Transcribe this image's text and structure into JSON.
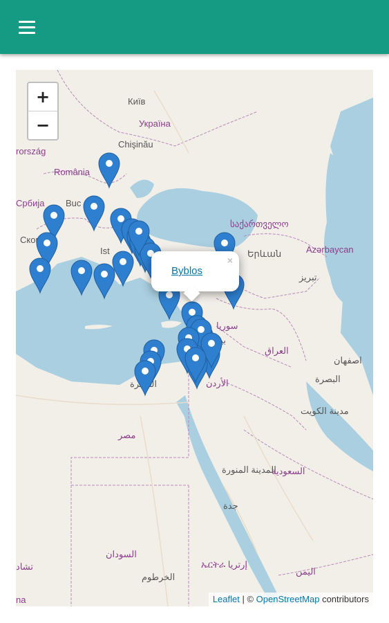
{
  "appbar": {
    "menu_icon": "hamburger-menu-icon",
    "color": "#159b84"
  },
  "map": {
    "zoom_in": "+",
    "zoom_out": "−",
    "popup": {
      "title": "Byblos",
      "close": "×"
    },
    "attribution": {
      "leaflet": "Leaflet",
      "sep": " | © ",
      "osm": "OpenStreetMap",
      "tail": " contributors"
    },
    "marker_color": "#2e7fcf",
    "labels": [
      {
        "text": "Київ",
        "color": "#555"
      },
      {
        "text": "Україна",
        "color": "#8a3d8a"
      },
      {
        "text": "Chişinău",
        "color": "#555"
      },
      {
        "text": "România",
        "color": "#8a3d8a"
      },
      {
        "text": "Buc",
        "color": "#555"
      },
      {
        "text": "Ist",
        "color": "#555"
      },
      {
        "text": "Скоп",
        "color": "#555"
      },
      {
        "text": "Србија",
        "color": "#8a3d8a"
      },
      {
        "text": "rország",
        "color": "#8a3d8a"
      },
      {
        "text": "საქართველო",
        "color": "#8a3d8a"
      },
      {
        "text": "Երևան",
        "color": "#555"
      },
      {
        "text": "Azərbaycan",
        "color": "#8a3d8a"
      },
      {
        "text": "تبریز",
        "color": "#555"
      },
      {
        "text": "سوريا",
        "color": "#8a3d8a"
      },
      {
        "text": "العراق",
        "color": "#8a3d8a"
      },
      {
        "text": "اصفهان",
        "color": "#555"
      },
      {
        "text": "البصرة",
        "color": "#555"
      },
      {
        "text": "مدينة الكويت",
        "color": "#555"
      },
      {
        "text": "الأردن",
        "color": "#8a3d8a"
      },
      {
        "text": "مصر",
        "color": "#8a3d8a"
      },
      {
        "text": "المدينة المنورة",
        "color": "#555"
      },
      {
        "text": "السعودية",
        "color": "#8a3d8a"
      },
      {
        "text": "جدة",
        "color": "#555"
      },
      {
        "text": "السودان",
        "color": "#8a3d8a"
      },
      {
        "text": "الخرطوم",
        "color": "#555"
      },
      {
        "text": "ኤርትራ إرتريا",
        "color": "#8a3d8a"
      },
      {
        "text": "اليمن",
        "color": "#8a3d8a"
      },
      {
        "text": "تشاد",
        "color": "#8a3d8a"
      },
      {
        "text": "na",
        "color": "#8a3d8a"
      },
      {
        "text": "القاهرة",
        "color": "#555"
      },
      {
        "text": "بيرو",
        "color": "#555"
      }
    ]
  }
}
